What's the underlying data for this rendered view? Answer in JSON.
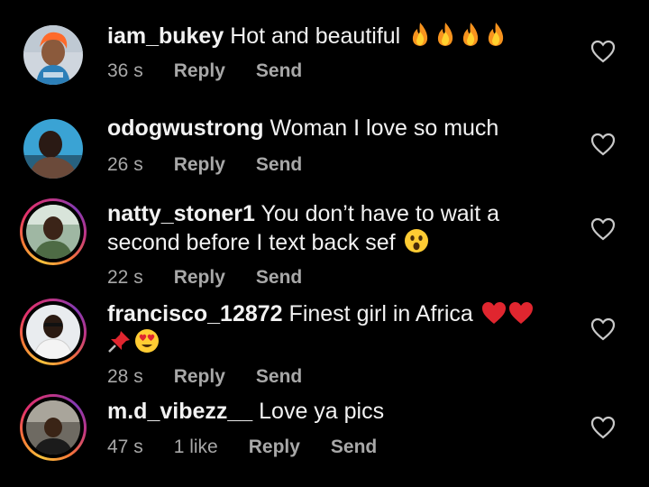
{
  "comments": [
    {
      "username": "iam_bukey",
      "text": "Hot and beautiful",
      "time": "36 s",
      "reply_label": "Reply",
      "send_label": "Send",
      "emojis": [
        "fire",
        "fire",
        "fire",
        "fire"
      ],
      "story_ring": false
    },
    {
      "username": "odogwustrong",
      "text": "Woman I love so much",
      "time": "26 s",
      "reply_label": "Reply",
      "send_label": "Send",
      "story_ring": false
    },
    {
      "username": "natty_stoner1",
      "text": "You don’t have to wait a second before I text back sef",
      "time": "22 s",
      "reply_label": "Reply",
      "send_label": "Send",
      "emojis": [
        "astonished-face"
      ],
      "story_ring": true
    },
    {
      "username": "francisco_12872",
      "text": "Finest girl in Africa",
      "time": "28 s",
      "reply_label": "Reply",
      "send_label": "Send",
      "emojis": [
        "red-heart",
        "red-heart",
        "pushpin",
        "heart-eyes-face"
      ],
      "story_ring": true
    },
    {
      "username": "m.d_vibezz__",
      "text": "Love ya pics",
      "time": "47 s",
      "likes": "1 like",
      "reply_label": "Reply",
      "send_label": "Send",
      "story_ring": true
    }
  ],
  "colors": {
    "background": "#000000",
    "text": "#f2f2f2",
    "meta": "#a8a8a8",
    "ring_gradient": [
      "#f9c23c",
      "#f77737",
      "#e1306c",
      "#c13584",
      "#833ab4"
    ]
  },
  "icons": {
    "like": "heart-outline-icon"
  }
}
